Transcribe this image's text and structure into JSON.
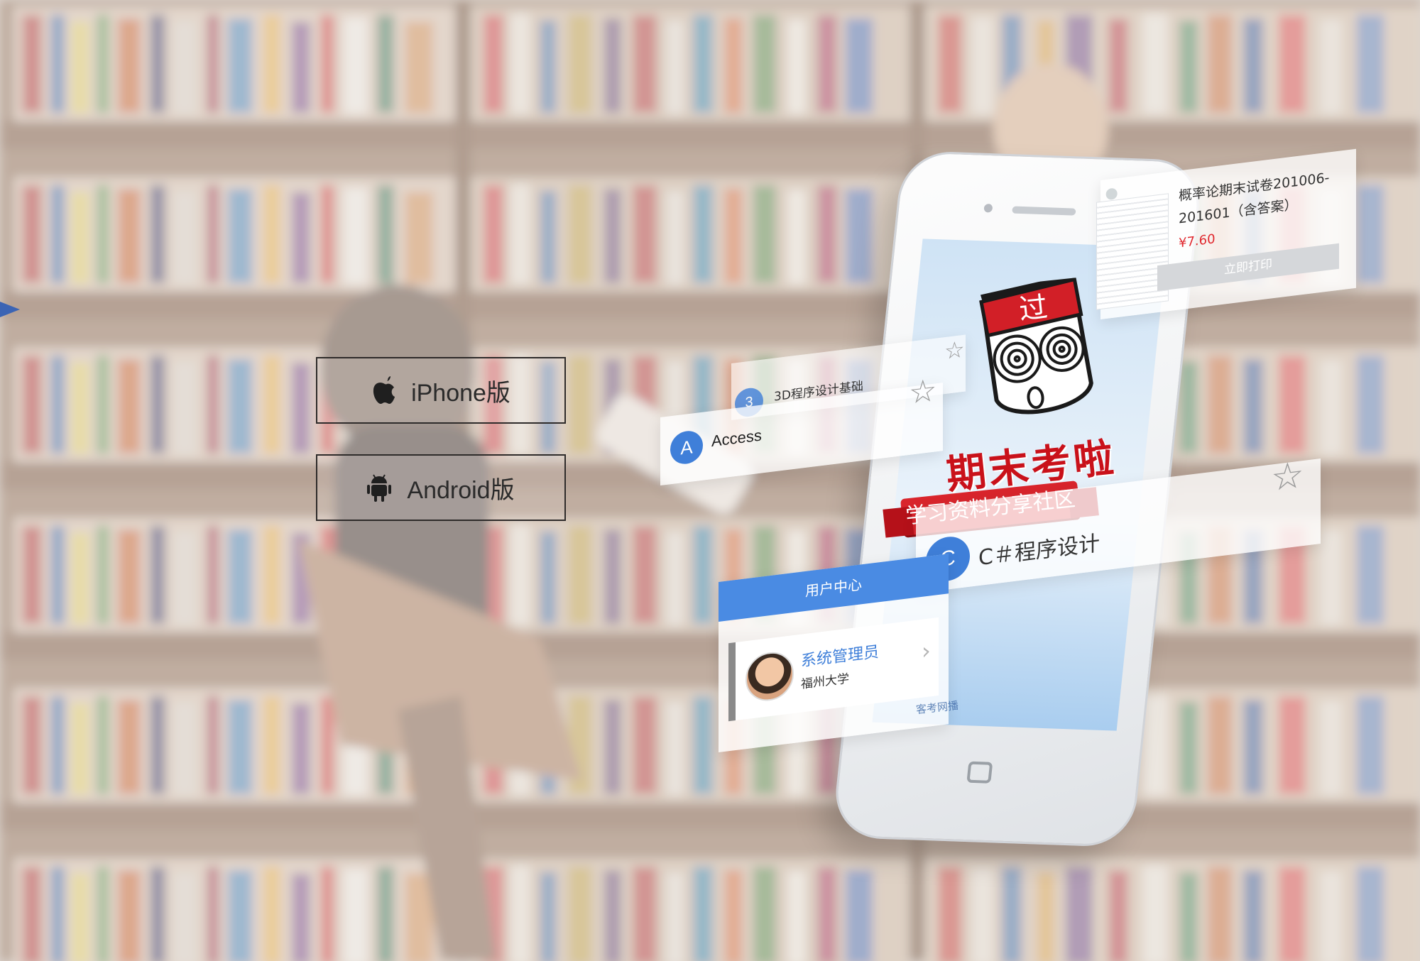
{
  "download": {
    "iphone_label": "iPhone版",
    "android_label": "Android版"
  },
  "app": {
    "logo_text": "过",
    "title": "期末考啦",
    "slogan": "学习资料分享社区",
    "footer_text": "客考网播"
  },
  "cards": {
    "course_3d": {
      "letter": "3",
      "title": "3D程序设计基础"
    },
    "access": {
      "letter": "A",
      "title": "Access"
    },
    "csharp": {
      "letter": "C",
      "title": "C＃程序设计"
    },
    "exam": {
      "title": "概率论期末试卷201006-201601（含答案）",
      "price": "¥7.60",
      "print_label": "立即打印"
    },
    "user_center": {
      "header": "用户中心",
      "name": "系统管理员",
      "school": "福州大学"
    }
  },
  "colors": {
    "accent_blue": "#3f7fd9",
    "brand_red": "#d9252c",
    "price_red": "#e0282e"
  }
}
